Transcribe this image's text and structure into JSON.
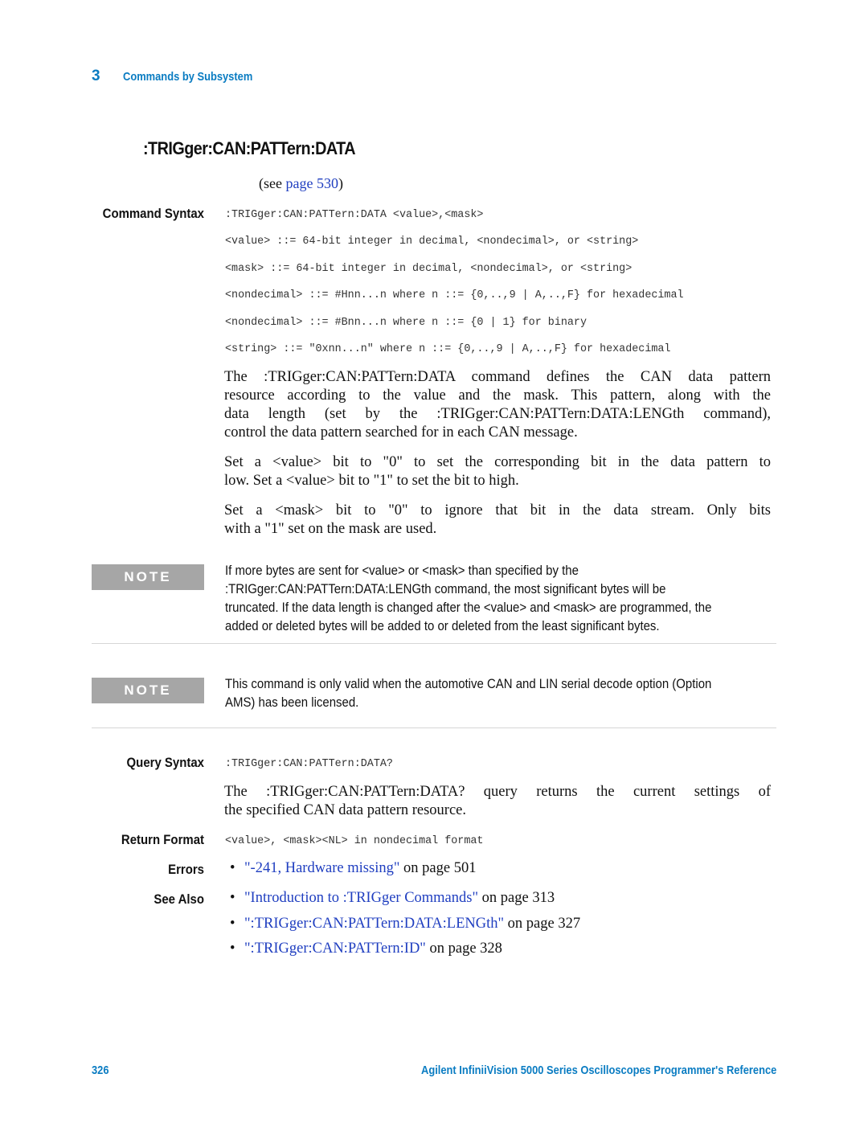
{
  "header": {
    "chapter_number": "3",
    "chapter_title": "Commands by Subsystem"
  },
  "command": {
    "title": ":TRIGger:CAN:PATTern:DATA",
    "see_prefix": "(see ",
    "see_link": "page 530",
    "see_suffix": ")"
  },
  "command_syntax": {
    "label": "Command Syntax",
    "lines": [
      ":TRIGger:CAN:PATTern:DATA <value>,<mask>",
      "<value> ::= 64-bit integer in decimal, <nondecimal>, or <string>",
      "<mask> ::= 64-bit integer in decimal, <nondecimal>, or <string>",
      "<nondecimal> ::= #Hnn...n where n ::= {0,..,9 | A,..,F} for hexadecimal",
      "<nondecimal> ::= #Bnn...n where n ::= {0 | 1} for binary",
      "<string> ::= \"0xnn...n\" where n ::= {0,..,9 | A,..,F} for hexadecimal"
    ],
    "paragraphs": [
      [
        "The :TRIGger:CAN:PATTern:DATA command defines the CAN data pattern",
        "resource according to the value and the mask. This pattern, along with the",
        "data length (set by the :TRIGger:CAN:PATTern:DATA:LENGth command),",
        "control the data pattern searched for in each CAN message."
      ],
      [
        "Set a <value> bit to \"0\" to set the corresponding bit in the data pattern to",
        "low. Set a <value> bit to \"1\" to set the bit to high."
      ],
      [
        "Set a <mask> bit to \"0\" to ignore that bit in the data stream. Only bits",
        "with a \"1\" set on the mask are used."
      ]
    ]
  },
  "notes": [
    {
      "label": "NOTE",
      "lines": [
        "If more bytes are sent for <value> or <mask> than specified by the",
        ":TRIGger:CAN:PATTern:DATA:LENGth command, the most significant bytes will be",
        "truncated. If the data length is changed after the <value> and <mask> are programmed, the",
        "added or deleted bytes will be added to or deleted from the least significant bytes."
      ]
    },
    {
      "label": "NOTE",
      "lines": [
        "This command is only valid when the automotive CAN and LIN serial decode option (Option",
        "AMS) has been licensed."
      ]
    }
  ],
  "query_syntax": {
    "label": "Query Syntax",
    "code": ":TRIGger:CAN:PATTern:DATA?",
    "paragraph": [
      "The :TRIGger:CAN:PATTern:DATA? query returns the current settings of",
      "the specified CAN data pattern resource."
    ]
  },
  "return_format": {
    "label": "Return Format",
    "code": "<value>, <mask><NL> in nondecimal format"
  },
  "errors": {
    "label": "Errors",
    "items": [
      {
        "link": "\"-241, Hardware missing\"",
        "suffix": " on page 501"
      }
    ]
  },
  "see_also": {
    "label": "See Also",
    "items": [
      {
        "link": "\"Introduction to :TRIGger Commands\"",
        "suffix": " on page 313"
      },
      {
        "link": "\":TRIGger:CAN:PATTern:DATA:LENGth\"",
        "suffix": " on page 327"
      },
      {
        "link": "\":TRIGger:CAN:PATTern:ID\"",
        "suffix": " on page 328"
      }
    ]
  },
  "footer": {
    "page_number": "326",
    "book_title": "Agilent InfiniiVision 5000 Series Oscilloscopes Programmer's Reference"
  },
  "colors": {
    "accent": "#0a7cc2",
    "link": "#1f3ec0",
    "note_box": "#a6a6a6",
    "rule": "#d6d6d6"
  }
}
